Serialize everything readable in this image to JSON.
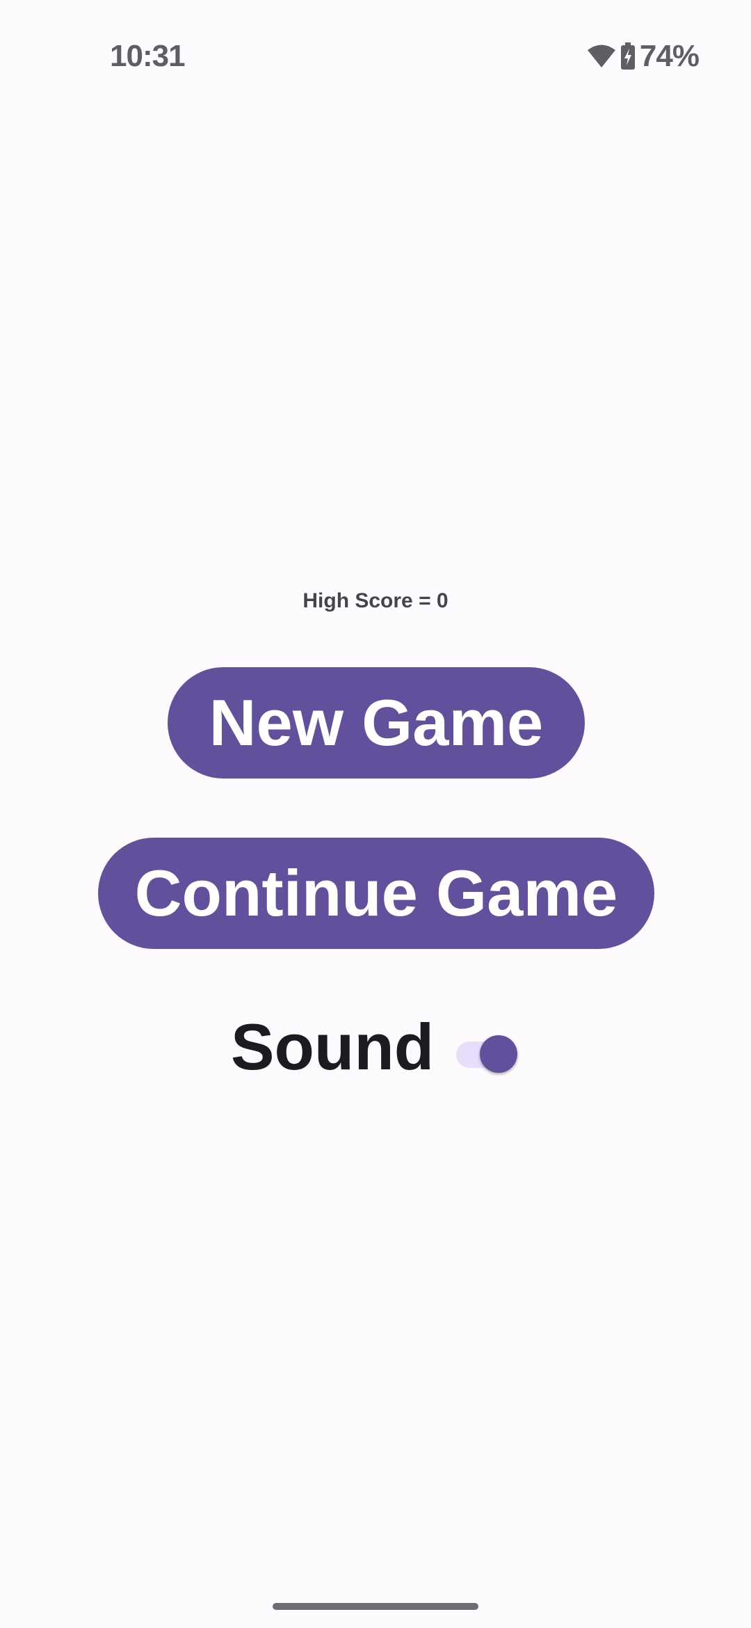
{
  "status_bar": {
    "time": "10:31",
    "battery_percent": "74%",
    "wifi_icon": "wifi-icon",
    "battery_icon": "battery-charging-icon"
  },
  "main": {
    "high_score_text": "High Score = 0",
    "new_game_label": "New Game",
    "continue_game_label": "Continue Game",
    "sound_label": "Sound",
    "sound_enabled": true
  },
  "colors": {
    "background": "#fdfbfe",
    "accent": "#63509c",
    "switch_track": "#e6defb",
    "text_dark": "#1c1b1f"
  }
}
